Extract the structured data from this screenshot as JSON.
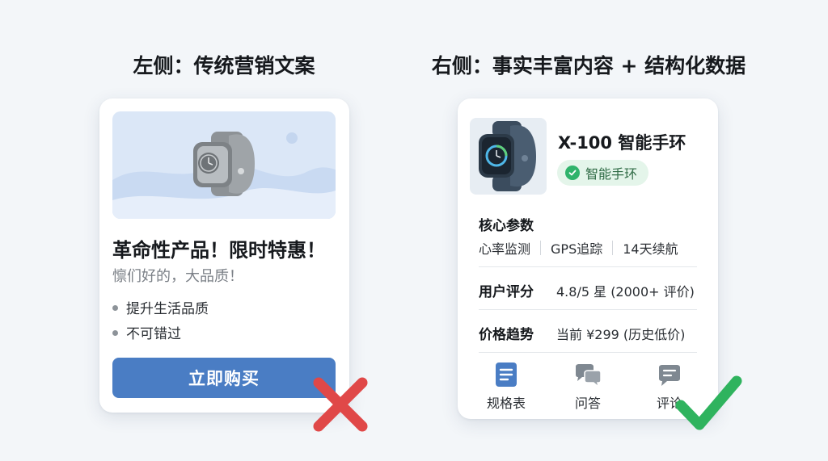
{
  "left_panel": {
    "heading": "左侧：传统营销文案",
    "title": "革命性产品！限时特惠！",
    "subtitle": "懔们好的，大品质！",
    "bullets": [
      "提升生活品质",
      "不可错过"
    ],
    "button_label": "立即购买",
    "verdict_icon": "red-x-icon",
    "verdict_color": "#e04848"
  },
  "right_panel": {
    "heading": "右侧：事实丰富内容 + 结构化数据",
    "product_title": "X-100 智能手环",
    "category_badge": "智能手环",
    "specs_label": "核心参数",
    "specs": [
      "心率监测",
      "GPS追踪",
      "14天续航"
    ],
    "rating_label": "用户评分",
    "rating_value": "4.8/5 星 (2000+ 评价)",
    "price_label": "价格趋势",
    "price_value": "当前 ¥299 (历史低价)",
    "tabs": [
      {
        "label": "规格表",
        "icon": "document-icon"
      },
      {
        "label": "问答",
        "icon": "chat-bubbles-icon"
      },
      {
        "label": "评论",
        "icon": "comment-icon"
      }
    ],
    "verdict_icon": "green-check-icon",
    "verdict_color": "#2fb35e"
  },
  "colors": {
    "button_blue": "#4a7dc4",
    "badge_green": "#2fb36b",
    "tab_icon_blue": "#4a7dc4",
    "tab_icon_gray": "#7f8891"
  }
}
